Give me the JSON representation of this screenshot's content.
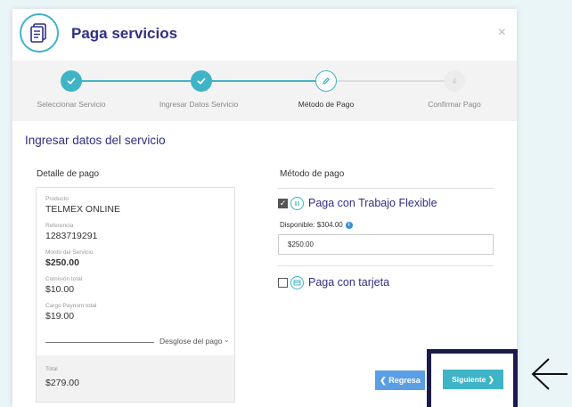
{
  "header": {
    "title": "Paga servicios",
    "close_label": "×"
  },
  "stepper": {
    "steps": [
      {
        "label": "Seleccionar Servicio",
        "state": "done"
      },
      {
        "label": "Ingresar Datos Servicio",
        "state": "done"
      },
      {
        "label": "Método de Pago",
        "state": "current"
      },
      {
        "label": "Confirmar Pago",
        "state": "todo",
        "number": "4"
      }
    ]
  },
  "section_title": "Ingresar datos del servicio",
  "detalle": {
    "title": "Detalle de pago",
    "items": [
      {
        "label": "Producto",
        "value": "TELMEX ONLINE"
      },
      {
        "label": "Referencia",
        "value": "1283719291"
      },
      {
        "label": "Monto del Servicio",
        "value": "$250.00"
      },
      {
        "label": "Comisión total",
        "value": "$10.00"
      },
      {
        "label": "Cargo Paynom total",
        "value": "$19.00"
      }
    ],
    "desglose_label": "Desglose del pago",
    "total_label": "Total",
    "total_value": "$279.00"
  },
  "metodo": {
    "title": "Método de pago",
    "option1_label": "Paga con Trabajo Flexible",
    "option1_checked": true,
    "disponible_label": "Disponible: $304.00",
    "amount_value": "$250.00",
    "option2_label": "Paga con tarjeta",
    "option2_checked": false
  },
  "buttons": {
    "regresa_label": "❮ Regresa",
    "siguiente_label": "Siguiente ❯"
  },
  "colors": {
    "accent": "#3fb4c6",
    "title": "#2f2f86",
    "regresa": "#5a9fe6",
    "highlight": "#1b1b4b",
    "background": "#eaf5f7"
  }
}
